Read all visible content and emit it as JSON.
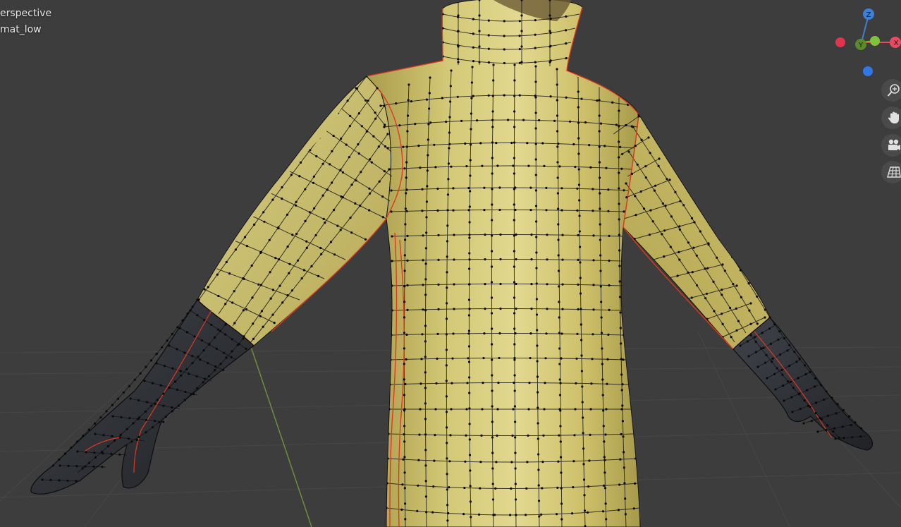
{
  "viewport": {
    "view_name": "erspective",
    "object_name": "mat_low"
  },
  "gizmo": {
    "labels": {
      "z": "Z",
      "y": "Y",
      "x": "X"
    },
    "colors": {
      "x": "#e84a5f",
      "y": "#7fc33a",
      "z": "#3f7fd6",
      "x_neg": "#e0354c",
      "z_neg": "#2f78e8"
    }
  },
  "navigation": [
    {
      "name": "zoom-icon"
    },
    {
      "name": "hand-pan-icon"
    },
    {
      "name": "camera-icon"
    },
    {
      "name": "grid-ortho-icon"
    }
  ],
  "colors": {
    "background": "#3d3d3d",
    "suit": "#c9bd63",
    "glove": "#2b2d31",
    "seam": "#e0381e",
    "wire": "#141414",
    "grid_line": "#4a4a4a",
    "y_axis_line": "#6b8f3a"
  }
}
